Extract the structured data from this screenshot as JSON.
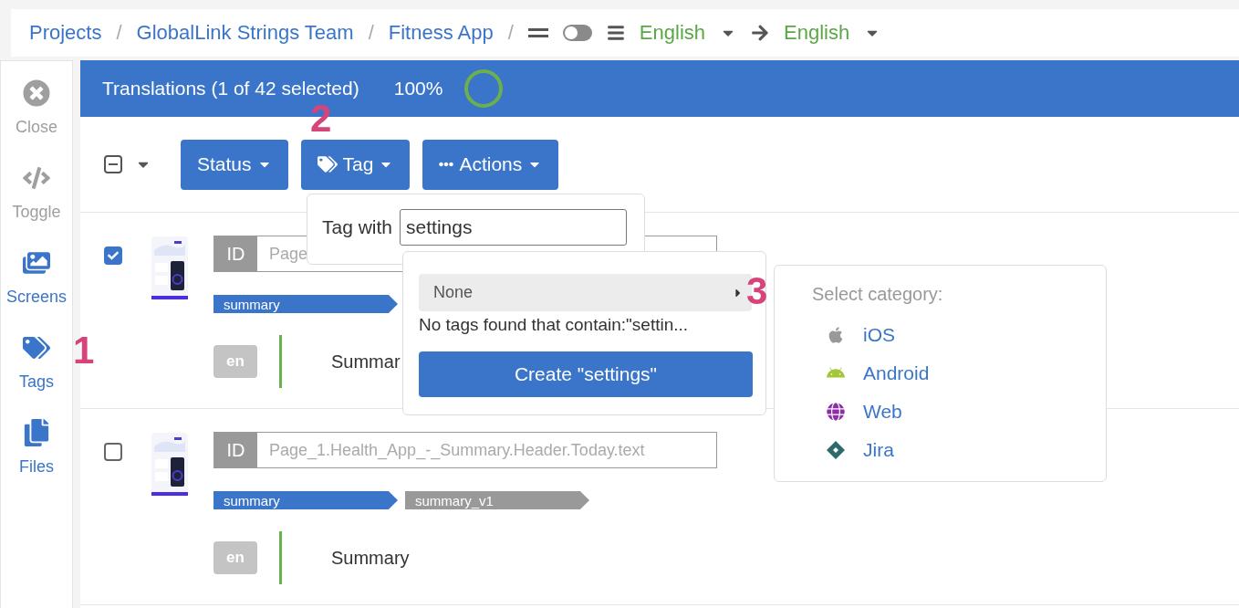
{
  "breadcrumb": [
    {
      "label": "Projects",
      "separator": "/"
    },
    {
      "label": "GlobalLink Strings Team",
      "separator": "/"
    },
    {
      "label": "Fitness App",
      "separator": "/"
    }
  ],
  "view_toggle": {
    "on": false
  },
  "languages": {
    "source": "English",
    "target": "English"
  },
  "sidebar": [
    {
      "label": "Close",
      "kind": "close",
      "disabled": true
    },
    {
      "label": "Toggle",
      "kind": "toggle",
      "disabled": true
    },
    {
      "label": "Screens",
      "kind": "screens",
      "disabled": false
    },
    {
      "label": "Tags",
      "kind": "tags",
      "disabled": false
    },
    {
      "label": "Files",
      "kind": "files",
      "disabled": false
    }
  ],
  "header": {
    "title": "Translations (1 of 42 selected)",
    "progress": "100%"
  },
  "toolbar": {
    "select_all": {
      "indeterminate": true
    },
    "buttons": [
      {
        "label": "Status",
        "kind": "plain"
      },
      {
        "label": "Tag",
        "kind": "tag"
      },
      {
        "label": "Actions",
        "kind": "more"
      }
    ]
  },
  "rows": [
    {
      "checked": true,
      "id_label": "ID",
      "id": "Page",
      "tags": [
        {
          "label": "summary",
          "color": "#3a75c9"
        }
      ],
      "lang": "en",
      "text": "Summar"
    },
    {
      "checked": false,
      "id_label": "ID",
      "id": "Page_1.Health_App_-_Summary.Header.Today.text",
      "tags": [
        {
          "label": "summary",
          "color": "#3a75c9"
        },
        {
          "label": "summary_v1",
          "color": "#999999"
        }
      ],
      "lang": "en",
      "text": "Summary"
    }
  ],
  "tag_popover": {
    "label": "Tag with",
    "value": "settings"
  },
  "tag_menu": {
    "option": "None",
    "message": "No tags found that contain:\"settin...",
    "create_button": "Create \"settings\""
  },
  "category_menu": {
    "title": "Select category:",
    "items": [
      {
        "label": "iOS",
        "kind": "ios"
      },
      {
        "label": "Android",
        "kind": "android"
      },
      {
        "label": "Web",
        "kind": "web"
      },
      {
        "label": "Jira",
        "kind": "jira"
      }
    ]
  },
  "annotations": [
    "1",
    "2",
    "3"
  ]
}
